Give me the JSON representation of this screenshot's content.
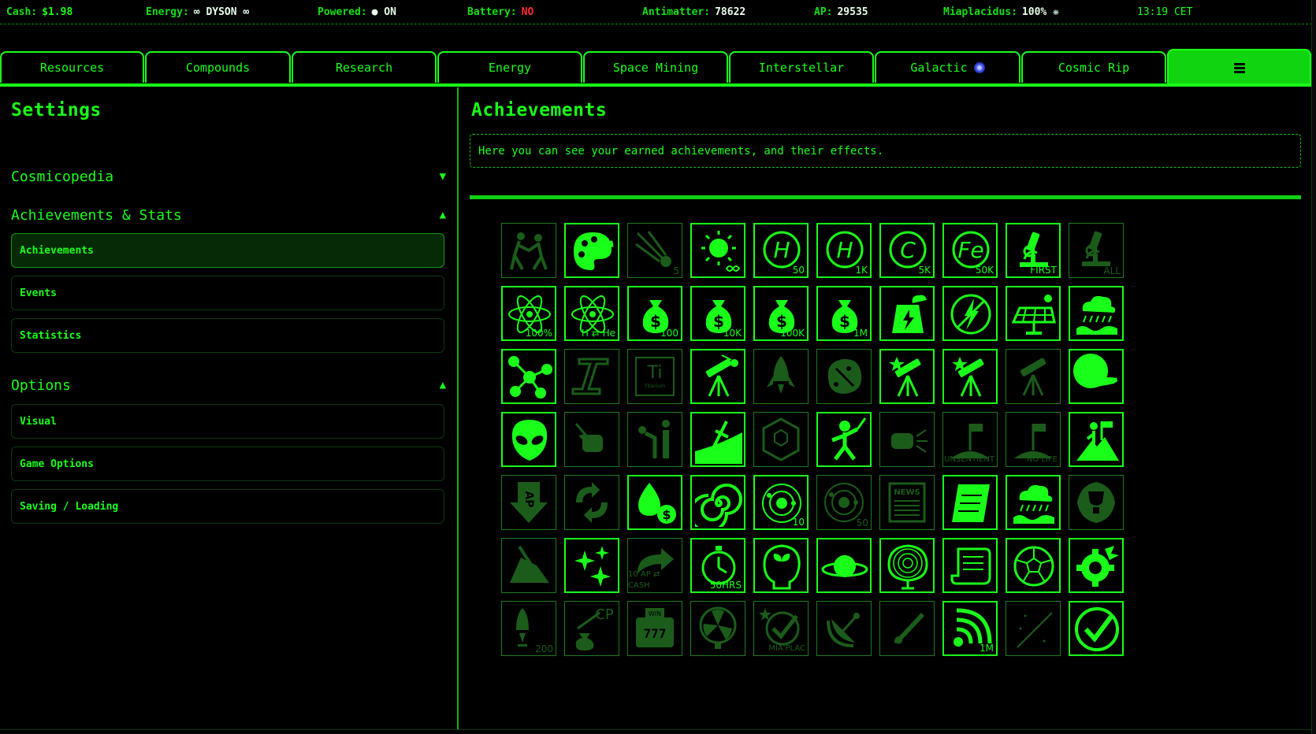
{
  "status": {
    "cash": {
      "label": "Cash:",
      "value": "$1.98"
    },
    "energy": {
      "label": "Energy:",
      "value": "∞ DYSON ∞"
    },
    "powered": {
      "label": "Powered:",
      "value": "● ON"
    },
    "battery": {
      "label": "Battery:",
      "value": "NO"
    },
    "antimatter": {
      "label": "Antimatter:",
      "value": "78622"
    },
    "ap": {
      "label": "AP:",
      "value": "29535"
    },
    "miaplacidus": {
      "label": "Miaplacidus:",
      "value": "100% ❋"
    },
    "clock": "13:19 CET"
  },
  "tabs": [
    "Resources",
    "Compounds",
    "Research",
    "Energy",
    "Space Mining",
    "Interstellar",
    "Galactic",
    "Cosmic Rip"
  ],
  "left": {
    "title": "Settings",
    "cosmicopedia": "Cosmicopedia",
    "achievements_stats": "Achievements & Stats",
    "nav1": [
      "Achievements",
      "Events",
      "Statistics"
    ],
    "options": "Options",
    "nav2": [
      "Visual",
      "Game Options",
      "Saving / Loading"
    ]
  },
  "main": {
    "title": "Achievements",
    "description": "Here you can see your earned achievements, and their effects."
  },
  "achievements": [
    {
      "icon": "people-dancing-icon",
      "earned": false,
      "cap": ""
    },
    {
      "icon": "paint-palette-icon",
      "earned": true,
      "cap": ""
    },
    {
      "icon": "comet-icon",
      "earned": false,
      "cap": "5"
    },
    {
      "icon": "sun-infinity-icon",
      "earned": true,
      "cap": ""
    },
    {
      "icon": "hydrogen-icon",
      "earned": true,
      "cap": "50"
    },
    {
      "icon": "hydrogen-icon",
      "earned": true,
      "cap": "1K"
    },
    {
      "icon": "carbon-icon",
      "earned": true,
      "cap": "5K"
    },
    {
      "icon": "iron-icon",
      "earned": true,
      "cap": "50K"
    },
    {
      "icon": "microscope-icon",
      "earned": true,
      "cap": "FIRST"
    },
    {
      "icon": "microscope-icon",
      "earned": false,
      "cap": "ALL"
    },
    {
      "icon": "atom-icon",
      "earned": true,
      "cap": "100%"
    },
    {
      "icon": "atom-icon",
      "earned": true,
      "cap": "H ⇄ He"
    },
    {
      "icon": "money-bag-icon",
      "earned": true,
      "cap": "100"
    },
    {
      "icon": "money-bag-icon",
      "earned": true,
      "cap": "10K"
    },
    {
      "icon": "money-bag-icon",
      "earned": true,
      "cap": "100K"
    },
    {
      "icon": "money-bag-icon",
      "earned": true,
      "cap": "1M"
    },
    {
      "icon": "power-plant-icon",
      "earned": true,
      "cap": ""
    },
    {
      "icon": "no-power-icon",
      "earned": true,
      "cap": ""
    },
    {
      "icon": "solar-panel-icon",
      "earned": true,
      "cap": ""
    },
    {
      "icon": "rain-flood-icon",
      "earned": true,
      "cap": ""
    },
    {
      "icon": "methane-molecule-icon",
      "earned": true,
      "cap": ""
    },
    {
      "icon": "steel-beam-icon",
      "earned": false,
      "cap": ""
    },
    {
      "icon": "titanium-element-icon",
      "earned": false,
      "cap": ""
    },
    {
      "icon": "telescope-comet-icon",
      "earned": true,
      "cap": ""
    },
    {
      "icon": "rocket-icon",
      "earned": false,
      "cap": ""
    },
    {
      "icon": "asteroid-pickaxe-icon",
      "earned": false,
      "cap": ""
    },
    {
      "icon": "star-telescope-icon",
      "earned": true,
      "cap": ""
    },
    {
      "icon": "star-telescope-icon",
      "earned": true,
      "cap": ""
    },
    {
      "icon": "telescope-icon",
      "earned": false,
      "cap": ""
    },
    {
      "icon": "planet-starship-icon",
      "earned": true,
      "cap": ""
    },
    {
      "icon": "alien-head-icon",
      "earned": true,
      "cap": ""
    },
    {
      "icon": "fist-lightning-icon",
      "earned": false,
      "cap": ""
    },
    {
      "icon": "bowing-people-icon",
      "earned": false,
      "cap": ""
    },
    {
      "icon": "sword-in-ground-icon",
      "earned": true,
      "cap": ""
    },
    {
      "icon": "hexagon-cells-icon",
      "earned": false,
      "cap": ""
    },
    {
      "icon": "warrior-icon",
      "earned": true,
      "cap": ""
    },
    {
      "icon": "fist-burst-icon",
      "earned": false,
      "cap": ""
    },
    {
      "icon": "planet-flag-icon",
      "earned": false,
      "cap": "UNSENTIENT"
    },
    {
      "icon": "planet-flag-icon",
      "earned": false,
      "cap": "NO LIFE"
    },
    {
      "icon": "summit-flag-icon",
      "earned": true,
      "cap": ""
    },
    {
      "icon": "ap-down-arrow-icon",
      "earned": false,
      "cap": ""
    },
    {
      "icon": "handshake-cycle-icon",
      "earned": false,
      "cap": ""
    },
    {
      "icon": "drop-coins-icon",
      "earned": true,
      "cap": ""
    },
    {
      "icon": "spiral-galaxy-icon",
      "earned": true,
      "cap": ""
    },
    {
      "icon": "solar-system-icon",
      "earned": true,
      "cap": "10"
    },
    {
      "icon": "solar-system-icon",
      "earned": false,
      "cap": "50"
    },
    {
      "icon": "newspaper-icon",
      "earned": false,
      "cap": ""
    },
    {
      "icon": "newspaper-scroll-icon",
      "earned": true,
      "cap": ""
    },
    {
      "icon": "rain-flood-icon",
      "earned": true,
      "cap": ""
    },
    {
      "icon": "trophy-icon",
      "earned": false,
      "cap": ""
    },
    {
      "icon": "rock-pickaxe-icon",
      "earned": false,
      "cap": ""
    },
    {
      "icon": "sparkles-icon",
      "earned": true,
      "cap": ""
    },
    {
      "icon": "exchange-arrow-icon",
      "earned": false,
      "cap": "10 AP ⇄ CASH"
    },
    {
      "icon": "stopwatch-icon",
      "earned": true,
      "cap": "50HRS"
    },
    {
      "icon": "mind-plant-icon",
      "earned": true,
      "cap": ""
    },
    {
      "icon": "ringed-planet-icon",
      "earned": true,
      "cap": ""
    },
    {
      "icon": "brain-tree-icon",
      "earned": true,
      "cap": ""
    },
    {
      "icon": "scroll-icon",
      "earned": true,
      "cap": ""
    },
    {
      "icon": "soccer-ball-icon",
      "earned": true,
      "cap": ""
    },
    {
      "icon": "gear-splash-icon",
      "earned": true,
      "cap": ""
    },
    {
      "icon": "rocket-stack-icon",
      "earned": false,
      "cap": "200"
    },
    {
      "icon": "cp-money-bag-icon",
      "earned": false,
      "cap": ""
    },
    {
      "icon": "slot-machine-icon",
      "earned": false,
      "cap": ""
    },
    {
      "icon": "fan-icon",
      "earned": false,
      "cap": ""
    },
    {
      "icon": "star-checkmark-icon",
      "earned": false,
      "cap": "MIA'PLAC"
    },
    {
      "icon": "satellite-dish-icon",
      "earned": false,
      "cap": ""
    },
    {
      "icon": "meteor-streak-icon",
      "earned": false,
      "cap": ""
    },
    {
      "icon": "signal-icon",
      "earned": true,
      "cap": "1M"
    },
    {
      "icon": "shooting-star-icon",
      "earned": false,
      "cap": ""
    },
    {
      "icon": "checkmark-circle-icon",
      "earned": true,
      "cap": ""
    }
  ],
  "colors": {
    "accent": "#1aff1a",
    "locked": "#1b5c1b",
    "warn": "#ff2a2a",
    "background": "#000000"
  }
}
